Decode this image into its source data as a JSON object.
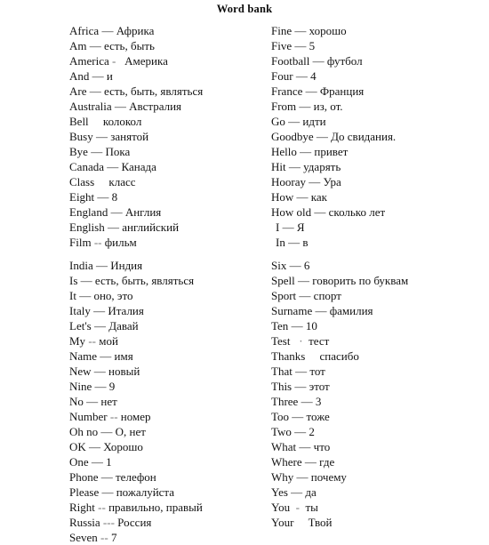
{
  "title": "Word bank",
  "columns": [
    {
      "name": "column-left",
      "entries": [
        {
          "term": "Africa",
          "sep": " — ",
          "gloss": "Африка",
          "style": "normal"
        },
        {
          "term": "Am",
          "sep": " — ",
          "gloss": "есть, быть",
          "style": "normal"
        },
        {
          "term": "America",
          "sep": " -   ",
          "gloss": "Америка",
          "style": "faint"
        },
        {
          "term": "And",
          "sep": " — ",
          "gloss": "и",
          "style": "normal"
        },
        {
          "term": "Are",
          "sep": " — ",
          "gloss": "есть, быть, являться",
          "style": "normal"
        },
        {
          "term": "Australia",
          "sep": " — ",
          "gloss": "Австралия",
          "style": "normal"
        },
        {
          "term": "Bell",
          "sep": "     ",
          "gloss": "колокол",
          "style": "blank"
        },
        {
          "term": "Busy",
          "sep": " — ",
          "gloss": "занятой",
          "style": "normal"
        },
        {
          "term": "Bye",
          "sep": " — ",
          "gloss": "Пока",
          "style": "normal"
        },
        {
          "term": "Canada",
          "sep": " — ",
          "gloss": "Канада",
          "style": "normal"
        },
        {
          "term": "Class",
          "sep": "     ",
          "gloss": "класс",
          "style": "blank"
        },
        {
          "term": "Eight",
          "sep": " — ",
          "gloss": "8",
          "style": "normal"
        },
        {
          "term": "England",
          "sep": " — ",
          "gloss": "Англия",
          "style": "normal"
        },
        {
          "term": "English",
          "sep": " — ",
          "gloss": "английский",
          "style": "normal"
        },
        {
          "term": "Film",
          "sep": " -- ",
          "gloss": "фильм",
          "style": "faint"
        },
        {
          "term": "India",
          "sep": " — ",
          "gloss": "Индия",
          "style": "normal",
          "break": true
        },
        {
          "term": "Is",
          "sep": " — ",
          "gloss": "есть, быть, являться",
          "style": "normal"
        },
        {
          "term": "It",
          "sep": " — ",
          "gloss": "оно, это",
          "style": "normal"
        },
        {
          "term": "Italy",
          "sep": " — ",
          "gloss": "Италия",
          "style": "normal"
        },
        {
          "term": "Let's",
          "sep": " — ",
          "gloss": "Давай",
          "style": "normal"
        },
        {
          "term": "My",
          "sep": " -- ",
          "gloss": "мой",
          "style": "faint"
        },
        {
          "term": "Name",
          "sep": " — ",
          "gloss": "имя",
          "style": "normal"
        },
        {
          "term": "New",
          "sep": " — ",
          "gloss": "новый",
          "style": "normal"
        },
        {
          "term": "Nine",
          "sep": " — ",
          "gloss": "9",
          "style": "normal"
        },
        {
          "term": "No",
          "sep": " — ",
          "gloss": "нет",
          "style": "normal"
        },
        {
          "term": "Number",
          "sep": " -- ",
          "gloss": "номер",
          "style": "faint"
        },
        {
          "term": "Oh no",
          "sep": " — ",
          "gloss": "О, нет",
          "style": "normal"
        },
        {
          "term": "OK",
          "sep": " — ",
          "gloss": "Хорошо",
          "style": "normal"
        },
        {
          "term": "One",
          "sep": " — ",
          "gloss": "1",
          "style": "normal"
        },
        {
          "term": "Phone",
          "sep": " — ",
          "gloss": "телефон",
          "style": "normal"
        },
        {
          "term": "Please",
          "sep": " — ",
          "gloss": "пожалуйста",
          "style": "normal"
        },
        {
          "term": "Right",
          "sep": " -- ",
          "gloss": "правильно, правый",
          "style": "faint"
        },
        {
          "term": "Russia",
          "sep": " --- ",
          "gloss": "Россия",
          "style": "faint"
        },
        {
          "term": "Seven",
          "sep": " -- ",
          "gloss": "7",
          "style": "faint"
        }
      ]
    },
    {
      "name": "column-right",
      "entries": [
        {
          "term": "Fine",
          "sep": " — ",
          "gloss": "хорошо",
          "style": "normal"
        },
        {
          "term": "Five",
          "sep": " — ",
          "gloss": "5",
          "style": "normal"
        },
        {
          "term": "Football",
          "sep": " — ",
          "gloss": "футбол",
          "style": "normal"
        },
        {
          "term": "Four",
          "sep": " — ",
          "gloss": "4",
          "style": "normal"
        },
        {
          "term": "France",
          "sep": " — ",
          "gloss": "Франция",
          "style": "normal"
        },
        {
          "term": "From",
          "sep": " — ",
          "gloss": "из, от.",
          "style": "normal"
        },
        {
          "term": "Go",
          "sep": " — ",
          "gloss": "идти",
          "style": "normal"
        },
        {
          "term": "Goodbye",
          "sep": " — ",
          "gloss": "До свидания.",
          "style": "normal"
        },
        {
          "term": "Hello",
          "sep": " — ",
          "gloss": "привет",
          "style": "normal"
        },
        {
          "term": "Hit",
          "sep": " — ",
          "gloss": "ударять",
          "style": "normal"
        },
        {
          "term": "Hooray",
          "sep": " — ",
          "gloss": "Ура",
          "style": "normal"
        },
        {
          "term": "How",
          "sep": " — ",
          "gloss": "как",
          "style": "normal"
        },
        {
          "term": "How old",
          "sep": " — ",
          "gloss": "сколько лет",
          "style": "normal"
        },
        {
          "term": "I",
          "sep": " — ",
          "gloss": "Я",
          "style": "normal",
          "indent": true
        },
        {
          "term": "In",
          "sep": " — ",
          "gloss": "в",
          "style": "normal",
          "indent": true
        },
        {
          "term": "Six",
          "sep": " — ",
          "gloss": "6",
          "style": "normal",
          "break": true
        },
        {
          "term": "Spell",
          "sep": " — ",
          "gloss": "говорить по буквам",
          "style": "normal"
        },
        {
          "term": "Sport",
          "sep": " — ",
          "gloss": "спорт",
          "style": "normal"
        },
        {
          "term": "Surname",
          "sep": " — ",
          "gloss": "фамилия",
          "style": "normal"
        },
        {
          "term": "Ten",
          "sep": " — ",
          "gloss": "10",
          "style": "normal"
        },
        {
          "term": "Test",
          "sep": "   ·  ",
          "gloss": "тест",
          "style": "faint"
        },
        {
          "term": "Thanks",
          "sep": "     ",
          "gloss": "спасибо",
          "style": "blank"
        },
        {
          "term": "That",
          "sep": " — ",
          "gloss": "тот",
          "style": "normal"
        },
        {
          "term": "This",
          "sep": " — ",
          "gloss": "этот",
          "style": "normal"
        },
        {
          "term": "Three",
          "sep": " — ",
          "gloss": "3",
          "style": "normal"
        },
        {
          "term": "Too",
          "sep": " — ",
          "gloss": "тоже",
          "style": "normal"
        },
        {
          "term": "Two",
          "sep": " — ",
          "gloss": "2",
          "style": "normal"
        },
        {
          "term": "What",
          "sep": " — ",
          "gloss": "что",
          "style": "normal"
        },
        {
          "term": "Where",
          "sep": " — ",
          "gloss": "где",
          "style": "normal"
        },
        {
          "term": "Why",
          "sep": " — ",
          "gloss": "почему",
          "style": "normal"
        },
        {
          "term": "Yes",
          "sep": " — ",
          "gloss": "да",
          "style": "normal"
        },
        {
          "term": "You",
          "sep": "  -  ",
          "gloss": "ты",
          "style": "faint"
        },
        {
          "term": "Your",
          "sep": "     ",
          "gloss": "Твой",
          "style": "blank"
        }
      ]
    }
  ]
}
